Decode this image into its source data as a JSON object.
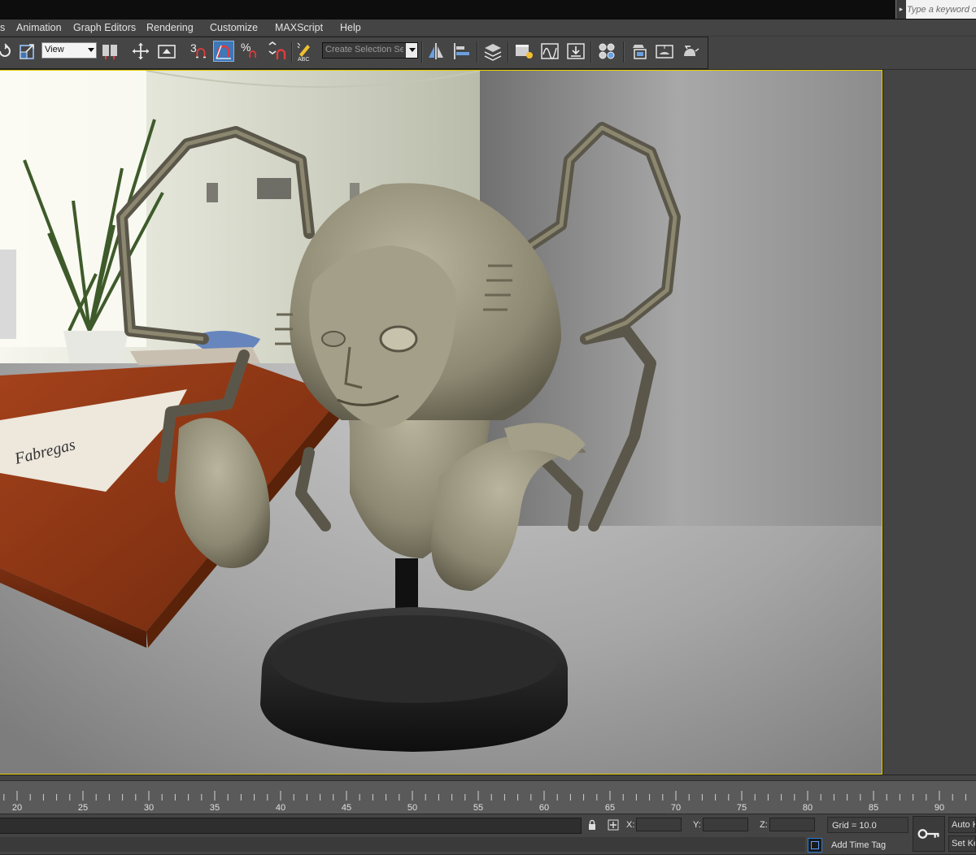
{
  "search": {
    "placeholder": "Type a keyword o"
  },
  "menu": {
    "items": [
      "s",
      "Animation",
      "Graph Editors",
      "Rendering",
      "Customize",
      "MAXScript",
      "Help"
    ]
  },
  "toolbar": {
    "ref_coord_value": "View",
    "snap_angle_label": "3",
    "percent_label": "%",
    "named_selection_placeholder": "Create Selection Se",
    "abc_label": "ABC"
  },
  "viewport": {
    "paper_text": "Fabregas"
  },
  "timeline": {
    "tick_labels": [
      "20",
      "25",
      "30",
      "35",
      "40",
      "45",
      "50",
      "55",
      "60",
      "65",
      "70",
      "75",
      "80",
      "85",
      "90"
    ]
  },
  "status": {
    "x_label": "X:",
    "y_label": "Y:",
    "z_label": "Z:",
    "x_value": "",
    "y_value": "",
    "z_value": "",
    "grid_text": "Grid = 10.0",
    "add_time_tag": "Add Time Tag",
    "auto_key": "Auto Key",
    "set_key": "Set Key"
  },
  "colors": {
    "viewport_border": "#e6d000",
    "active_tool": "#3f77b8",
    "ui_background": "#444444"
  }
}
